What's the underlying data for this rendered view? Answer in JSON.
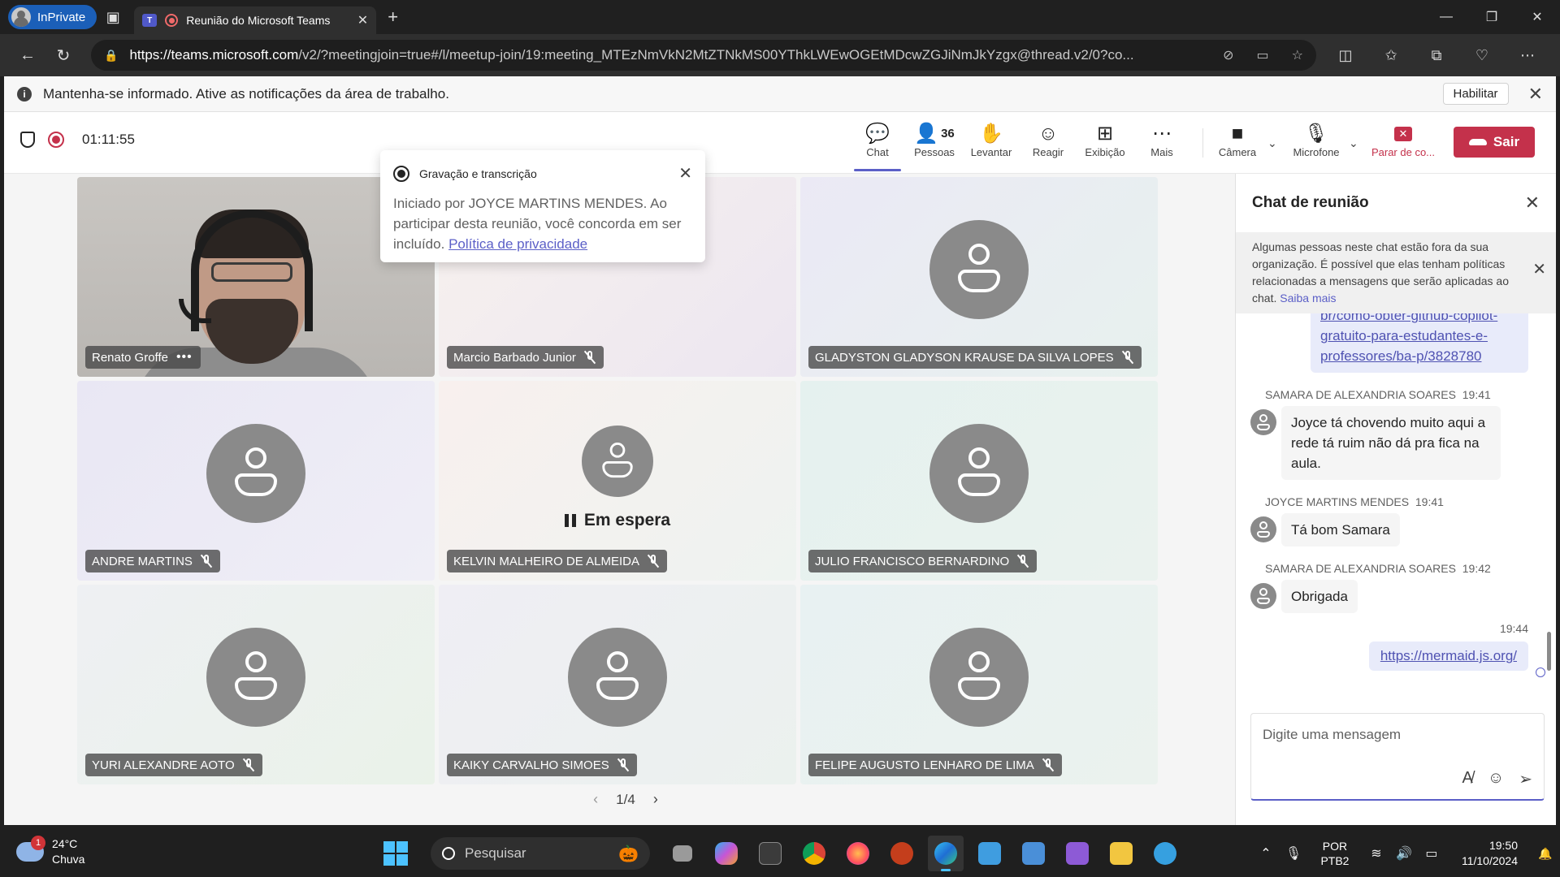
{
  "browser": {
    "inprivate_label": "InPrivate",
    "tab_title": "Reunião do Microsoft Teams",
    "url_domain": "https://teams.microsoft.com",
    "url_rest": "/v2/?meetingjoin=true#/l/meetup-join/19:meeting_MTEzNmVkN2MtZTNkMS00YThkLWEwOGEtMDcwZGJiNmJkYzgx@thread.v2/0?co..."
  },
  "infobar": {
    "message": "Mantenha-se informado. Ative as notificações da área de trabalho.",
    "enable_label": "Habilitar"
  },
  "meeting": {
    "timer": "01:11:55",
    "people_count": "36",
    "tools": {
      "chat": "Chat",
      "people": "Pessoas",
      "raise": "Levantar",
      "react": "Reagir",
      "view": "Exibição",
      "more": "Mais",
      "camera": "Câmera",
      "mic": "Microfone",
      "stop": "Parar de co...",
      "leave": "Sair"
    }
  },
  "toast": {
    "title": "Gravação e transcrição",
    "body": "Iniciado por JOYCE MARTINS MENDES. Ao participar desta reunião, você concorda em ser incluído.",
    "link": "Política de privacidade"
  },
  "participants": [
    {
      "name": "Renato Groffe"
    },
    {
      "name": "Marcio Barbado Junior"
    },
    {
      "name": "GLADYSTON GLADYSON KRAUSE DA SILVA LOPES"
    },
    {
      "name": "ANDRE MARTINS"
    },
    {
      "name": "KELVIN MALHEIRO DE ALMEIDA"
    },
    {
      "name": "JULIO FRANCISCO BERNARDINO"
    },
    {
      "name": "YURI ALEXANDRE AOTO"
    },
    {
      "name": "KAIKY CARVALHO SIMOES"
    },
    {
      "name": "FELIPE AUGUSTO LENHARO DE LIMA"
    }
  ],
  "on_hold_label": "Em espera",
  "pager": "1/4",
  "chat": {
    "title": "Chat de reunião",
    "notice": "Algumas pessoas neste chat estão fora da sua organização. É possível que elas tenham políticas relacionadas a mensagens que serão aplicadas ao chat.",
    "notice_link": "Saiba mais",
    "top_link": "br/como-obter-github-copilot-gratuito-para-estudantes-e-professores/ba-p/3828780",
    "messages": [
      {
        "author": "SAMARA DE ALEXANDRIA SOARES",
        "time": "19:41",
        "text": "Joyce tá chovendo muito aqui a rede tá ruim não dá pra fica na aula."
      },
      {
        "author": "JOYCE MARTINS MENDES",
        "time": "19:41",
        "text": "Tá bom Samara"
      },
      {
        "author": "SAMARA DE ALEXANDRIA SOARES",
        "time": "19:42",
        "text": "Obrigada"
      }
    ],
    "mine_time": "19:44",
    "mine_link": "https://mermaid.js.org/",
    "composer_placeholder": "Digite uma mensagem"
  },
  "taskbar": {
    "weather_badge": "1",
    "temperature": "24°C",
    "condition": "Chuva",
    "search_placeholder": "Pesquisar",
    "lang_1": "POR",
    "lang_2": "PTB2",
    "time": "19:50",
    "date": "11/10/2024"
  }
}
